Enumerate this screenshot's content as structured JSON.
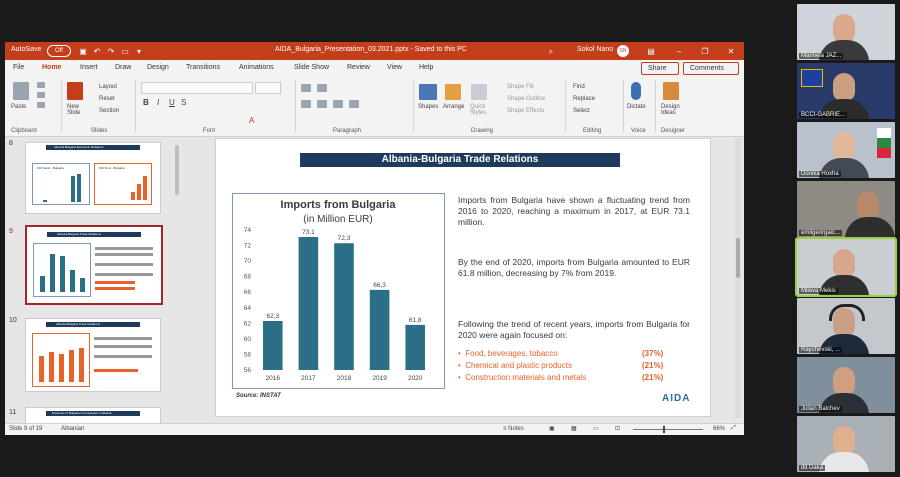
{
  "window": {
    "autosave_label": "AutoSave",
    "autosave_state": "Off",
    "file_title": "AIDA_Bulgaria_Presentation_03.2021.pptx  -  Saved to this PC",
    "user_name": "Sokol Nano",
    "user_initials": "SN"
  },
  "menu": {
    "tabs": [
      "File",
      "Home",
      "Insert",
      "Draw",
      "Design",
      "Transitions",
      "Animations",
      "Slide Show",
      "Review",
      "View",
      "Help"
    ],
    "active_tab": "Home",
    "share_label": "Share",
    "comments_label": "Comments"
  },
  "ribbon": {
    "paste_label": "Paste",
    "new_slide_label": "New Slide",
    "layout_label": "Layout",
    "reset_label": "Reset",
    "section_label": "Section",
    "shapes_label": "Shapes",
    "arrange_label": "Arrange",
    "quick_styles_label": "Quick Styles",
    "shape_fill_label": "Shape Fill",
    "shape_outline_label": "Shape Outline",
    "shape_effects_label": "Shape Effects",
    "find_label": "Find",
    "replace_label": "Replace",
    "select_label": "Select",
    "dictate_label": "Dictate",
    "design_ideas_label": "Design Ideas",
    "groups": [
      "Clipboard",
      "Slides",
      "Font",
      "Paragraph",
      "Drawing",
      "Editing",
      "Voice",
      "Designer"
    ]
  },
  "thumbnails": {
    "numbers": [
      "8",
      "9",
      "10",
      "11"
    ],
    "slide8_title": "Albania-Bulgaria Economic Relations",
    "slide8_left": "FDI Stock - Bulgaria",
    "slide8_right": "FDI Flow - Bulgaria",
    "slide9_title": "Albania-Bulgaria Trade Relations",
    "slide10_title": "Albania-Bulgaria Trade Relations",
    "slide11_title": "Presence of Bulgarian Companies in Albania"
  },
  "slide": {
    "title": "Albania-Bulgaria Trade Relations",
    "source": "Source: INSTAT",
    "logo": "AIDA",
    "para1": "Imports from Bulgaria have shown a fluctuating trend from 2016 to 2020, reaching a maximum in 2017, at EUR 73.1 million.",
    "para2": "By the end of 2020, imports from Bulgaria amounted to EUR 61.8 million, decreasing by 7% from 2019.",
    "para3": "Following the trend of recent years, imports from Bulgaria for 2020 were again focused on:",
    "bullets": [
      {
        "label": "Food, beverages, tobacco",
        "pct": "(37%)"
      },
      {
        "label": "Chemical and plastic products",
        "pct": "(21%)"
      },
      {
        "label": "Construction materials and metals",
        "pct": "(21%)"
      }
    ]
  },
  "chart_data": {
    "type": "bar",
    "title": "Imports from Bulgaria",
    "subtitle": "(in Million EUR)",
    "categories": [
      "2016",
      "2017",
      "2018",
      "2019",
      "2020"
    ],
    "values": [
      62.3,
      73.1,
      72.3,
      66.3,
      61.8
    ],
    "value_labels": [
      "62,3",
      "73,1",
      "72,3",
      "66,3",
      "61,8"
    ],
    "yticks": [
      "56",
      "58",
      "60",
      "62",
      "64",
      "66",
      "68",
      "70",
      "72",
      "74"
    ],
    "ylim": [
      56,
      74
    ],
    "grid": false,
    "color": "#2a6f87"
  },
  "status": {
    "slide_info": "Slide 9 of 19",
    "language": "Albanian",
    "notes_label": "Notes",
    "zoom": "66%"
  },
  "participants": [
    {
      "name": "Marinela JAZ..."
    },
    {
      "name": "BCCI-GABRIE..."
    },
    {
      "name": "Donika Hoxha"
    },
    {
      "name": "emilgeorgaic..."
    },
    {
      "name": "Mileva Meksi"
    },
    {
      "name": "Raychevski, ..."
    },
    {
      "name": "Julian Balchev"
    },
    {
      "name": "dit Daka"
    }
  ]
}
